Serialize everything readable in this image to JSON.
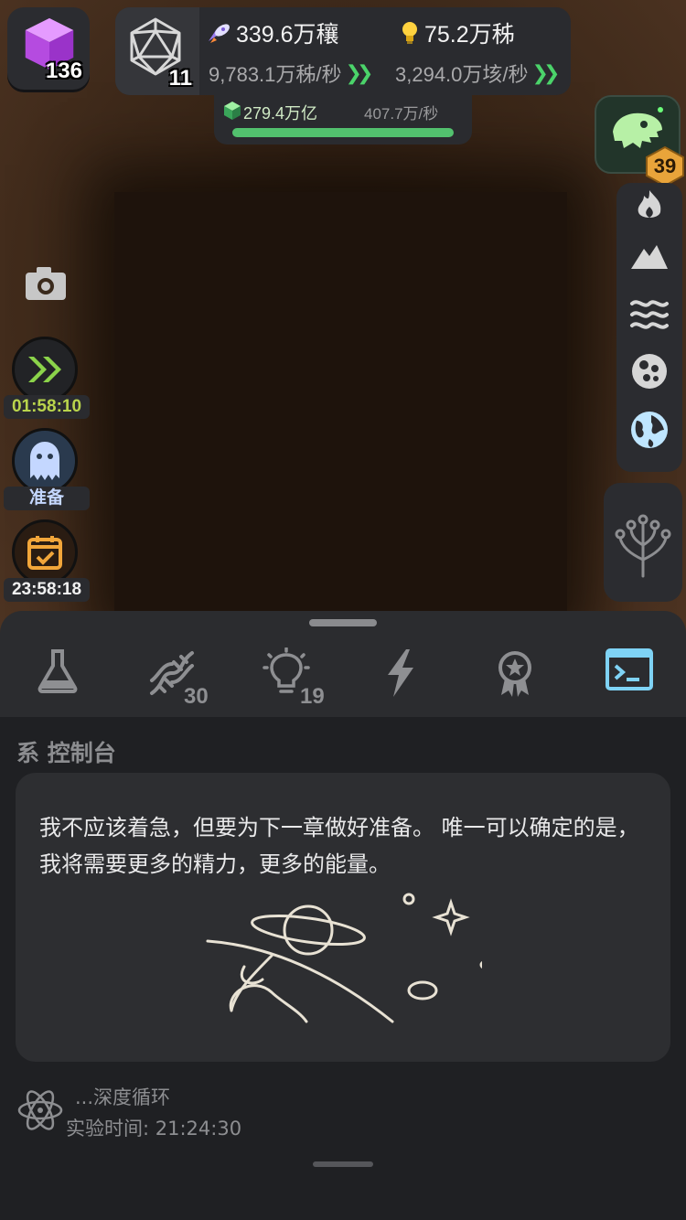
{
  "hud": {
    "level": "136",
    "d20_count": "11",
    "resource1": {
      "value": "339.6万穰",
      "rate": "9,783.1万秭/秒"
    },
    "resource2": {
      "value": "75.2万秭",
      "rate": "3,294.0万垓/秒"
    },
    "sub": {
      "value": "279.4万亿",
      "rate": "407.7万/秒",
      "progress": 1.0
    }
  },
  "right": {
    "dino_level": "39",
    "stack_icons": [
      "fire-icon",
      "mountain-icon",
      "waves-icon",
      "cells-icon",
      "globe-icon"
    ],
    "tree_icon": "branch-tree-icon"
  },
  "left": {
    "speed_timer": "01:58:10",
    "ghost_label": "准备",
    "calendar_timer": "23:58:18"
  },
  "tabs": [
    {
      "icon": "flask-icon",
      "badge": ""
    },
    {
      "icon": "dna-icon",
      "badge": "30"
    },
    {
      "icon": "lightbulb-icon",
      "badge": "19"
    },
    {
      "icon": "lightning-icon",
      "badge": ""
    },
    {
      "icon": "medal-icon",
      "badge": ""
    },
    {
      "icon": "terminal-icon",
      "badge": "",
      "active": true
    }
  ],
  "console": {
    "title": "系 控制台",
    "message": "我不应该着急，但要为下一章做好准备。 唯一可以确定的是，我将需要更多的精力，更多的能量。",
    "status_line1": "...深度循环",
    "status_line2": "实验时间: 21:24:30"
  },
  "colors": {
    "accent_green": "#4bd36a",
    "timer_green": "#b9d44c",
    "timer_orange": "#f2a63a",
    "active_tab": "#7fd3f5"
  }
}
